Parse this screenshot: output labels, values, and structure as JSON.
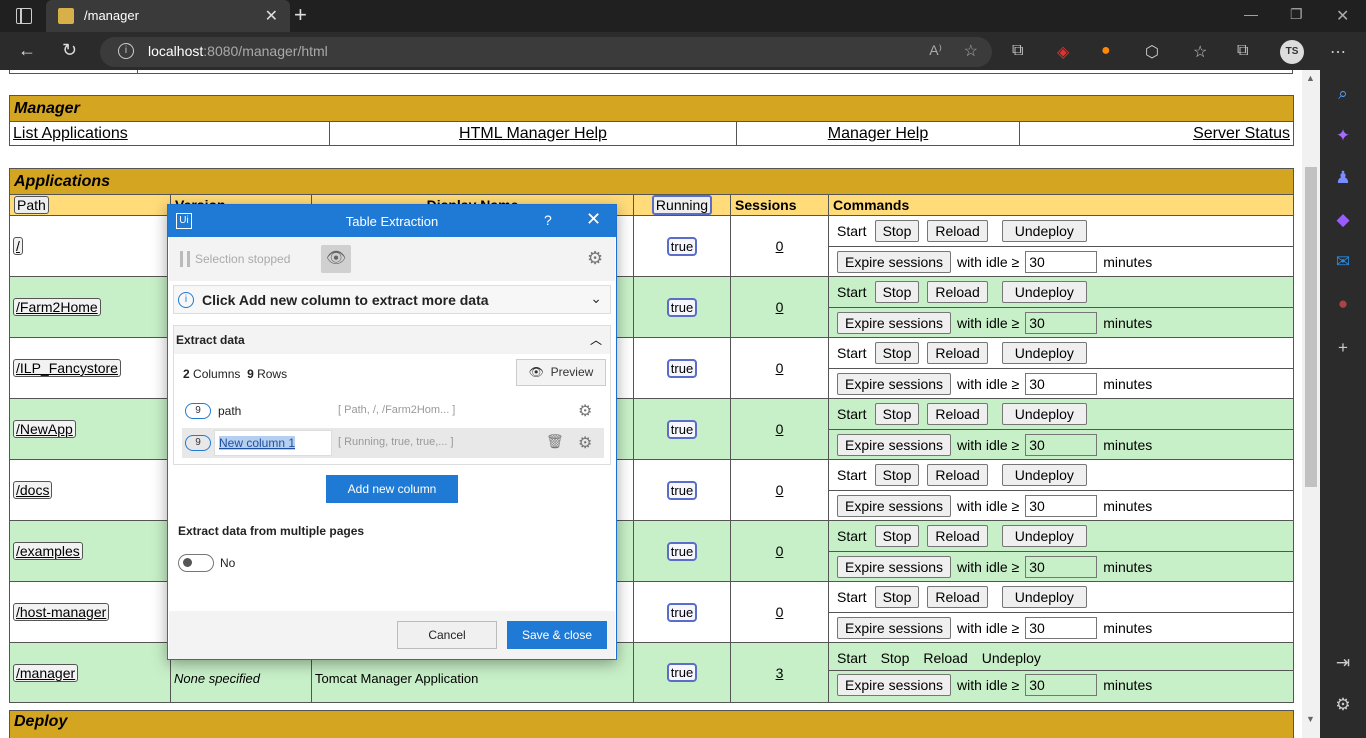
{
  "browser": {
    "tab_title": "/manager",
    "url_host": "localhost",
    "url_rest": ":8080/manager/html",
    "avatar_initials": "TS"
  },
  "manager": {
    "title": "Manager",
    "links": [
      "List Applications",
      "HTML Manager Help",
      "Manager Help",
      "Server Status"
    ]
  },
  "applications": {
    "title": "Applications",
    "columns": {
      "path": "Path",
      "version": "Version",
      "display_name": "Display Name",
      "running": "Running",
      "sessions": "Sessions",
      "commands": "Commands"
    },
    "rows": [
      {
        "path": "/",
        "version": "",
        "display_name": "",
        "running": "true",
        "sessions": "0"
      },
      {
        "path": "/Farm2Home",
        "version": "",
        "display_name": "",
        "running": "true",
        "sessions": "0"
      },
      {
        "path": "/ILP_Fancystore",
        "version": "",
        "display_name": "",
        "running": "true",
        "sessions": "0"
      },
      {
        "path": "/NewApp",
        "version": "",
        "display_name": "",
        "running": "true",
        "sessions": "0"
      },
      {
        "path": "/docs",
        "version": "",
        "display_name": "",
        "running": "true",
        "sessions": "0"
      },
      {
        "path": "/examples",
        "version": "",
        "display_name": "",
        "running": "true",
        "sessions": "0"
      },
      {
        "path": "/host-manager",
        "version": "",
        "display_name": "",
        "running": "true",
        "sessions": "0"
      },
      {
        "path": "/manager",
        "version": "None specified",
        "display_name": "Tomcat Manager Application",
        "running": "true",
        "sessions": "3"
      }
    ],
    "cmd": {
      "start": "Start",
      "stop": "Stop",
      "reload": "Reload",
      "undeploy": "Undeploy",
      "expire": "Expire sessions",
      "with_idle": "with idle ≥",
      "idle_value": "30",
      "minutes": "minutes"
    }
  },
  "deploy": {
    "title": "Deploy"
  },
  "dialog": {
    "title": "Table Extraction",
    "help": "?",
    "selection_status": "Selection stopped",
    "info_message": "Click Add new column to extract more data",
    "section_title": "Extract data",
    "columns_count": "2",
    "columns_label": "Columns",
    "rows_count": "9",
    "rows_label": "Rows",
    "preview_label": "Preview",
    "columns": [
      {
        "badge": "9",
        "name": "path",
        "preview": "[ Path, /, /Farm2Hom... ]"
      },
      {
        "badge": "9",
        "name": "New column 1",
        "preview": "[ Running, true, true,... ]"
      }
    ],
    "add_column_label": "Add new column",
    "multi_page_label": "Extract data from multiple pages",
    "toggle_value": "No",
    "cancel_label": "Cancel",
    "save_label": "Save & close"
  }
}
